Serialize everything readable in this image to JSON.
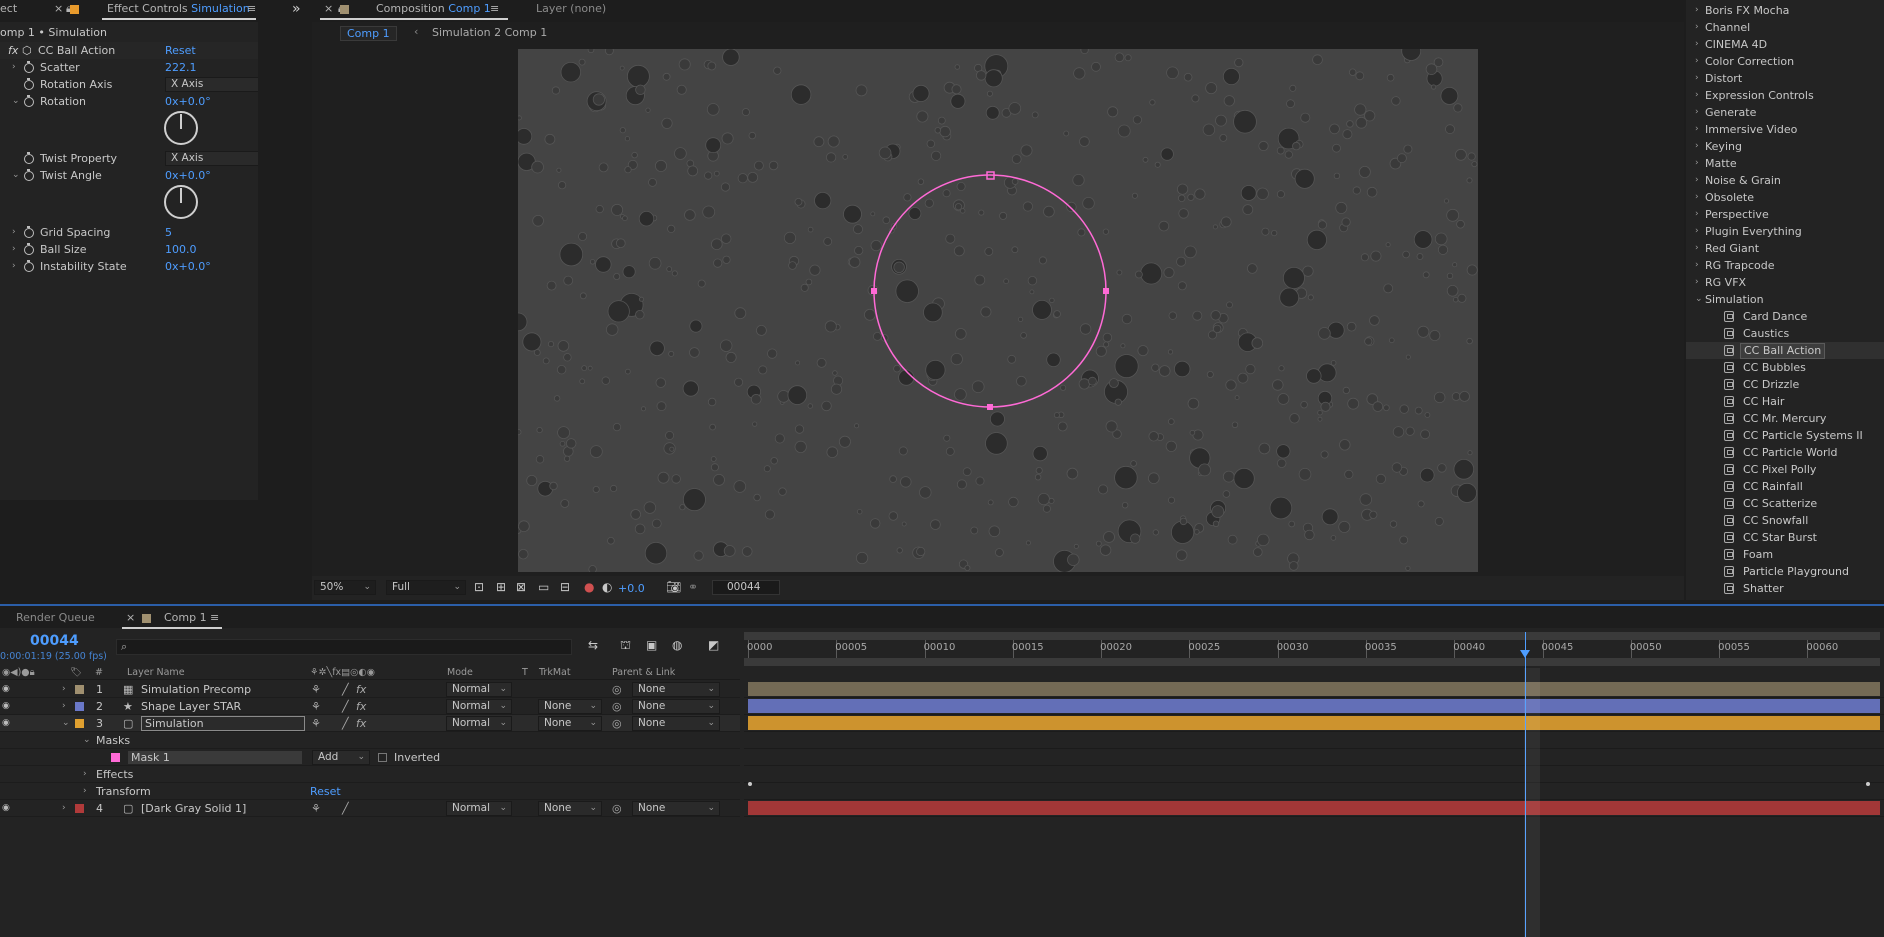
{
  "effect_controls": {
    "tab_prefix": "ect",
    "tab_label": "Effect Controls",
    "tab_layer": "Simulation",
    "breadcrumb": "omp 1 • Simulation",
    "effect_name": "CC Ball Action",
    "reset_label": "Reset",
    "properties": [
      {
        "name": "Scatter",
        "value": "222.1"
      },
      {
        "name": "Rotation Axis",
        "value": "X Axis"
      },
      {
        "name": "Rotation",
        "value": "0x+0.0°"
      },
      {
        "name": "Twist Property",
        "value": "X Axis"
      },
      {
        "name": "Twist Angle",
        "value": "0x+0.0°"
      },
      {
        "name": "Grid Spacing",
        "value": "5"
      },
      {
        "name": "Ball Size",
        "value": "100.0"
      },
      {
        "name": "Instability State",
        "value": "0x+0.0°"
      }
    ]
  },
  "composition": {
    "tab_label": "Composition",
    "tab_comp": "Comp 1",
    "layer_tab": "Layer (none)",
    "subtabs": [
      "Comp 1",
      "Simulation 2 Comp 1"
    ],
    "zoom": "50%",
    "resolution": "Full",
    "exposure": "+0.0",
    "timecode": "00044"
  },
  "effects_presets": {
    "categories": [
      "Boris FX Mocha",
      "Channel",
      "CINEMA 4D",
      "Color Correction",
      "Distort",
      "Expression Controls",
      "Generate",
      "Immersive Video",
      "Keying",
      "Matte",
      "Noise & Grain",
      "Obsolete",
      "Perspective",
      "Plugin Everything",
      "Red Giant",
      "RG Trapcode",
      "RG VFX",
      "Simulation"
    ],
    "simulation_items": [
      "Card Dance",
      "Caustics",
      "CC Ball Action",
      "CC Bubbles",
      "CC Drizzle",
      "CC Hair",
      "CC Mr. Mercury",
      "CC Particle Systems II",
      "CC Particle World",
      "CC Pixel Polly",
      "CC Rainfall",
      "CC Scatterize",
      "CC Snowfall",
      "CC Star Burst",
      "Foam",
      "Particle Playground",
      "Shatter"
    ],
    "selected": "CC Ball Action"
  },
  "timeline": {
    "tab_render_queue": "Render Queue",
    "tab_comp": "Comp 1",
    "timecode": "00044",
    "timecode_sub": "0:00:01:19 (25.00 fps)",
    "search_placeholder": "",
    "headers": {
      "num": "#",
      "layer_name": "Layer Name",
      "mode": "Mode",
      "t": "T",
      "trkmat": "TrkMat",
      "parent": "Parent & Link"
    },
    "layers": [
      {
        "num": "1",
        "name": "Simulation Precomp",
        "mode": "Normal",
        "trkmat": "",
        "parent": "None",
        "color": "#a09070"
      },
      {
        "num": "2",
        "name": "Shape Layer STAR",
        "mode": "Normal",
        "trkmat": "None",
        "parent": "None",
        "color": "#6a78c8"
      },
      {
        "num": "3",
        "name": "Simulation",
        "mode": "Normal",
        "trkmat": "None",
        "parent": "None",
        "color": "#e0a030"
      },
      {
        "num": "4",
        "name": "[Dark Gray Solid 1]",
        "mode": "Normal",
        "trkmat": "None",
        "parent": "None",
        "color": "#b03a3a"
      }
    ],
    "sub_rows": {
      "masks": "Masks",
      "mask1": "Mask 1",
      "mask_mode": "Add",
      "inverted": "Inverted",
      "effects": "Effects",
      "transform": "Transform",
      "reset": "Reset"
    },
    "ruler": [
      "0000",
      "00005",
      "00010",
      "00015",
      "00020",
      "00025",
      "00030",
      "00035",
      "00040",
      "00045",
      "00050",
      "00055",
      "00060"
    ],
    "current_frame": 44,
    "total_frames": 64
  }
}
